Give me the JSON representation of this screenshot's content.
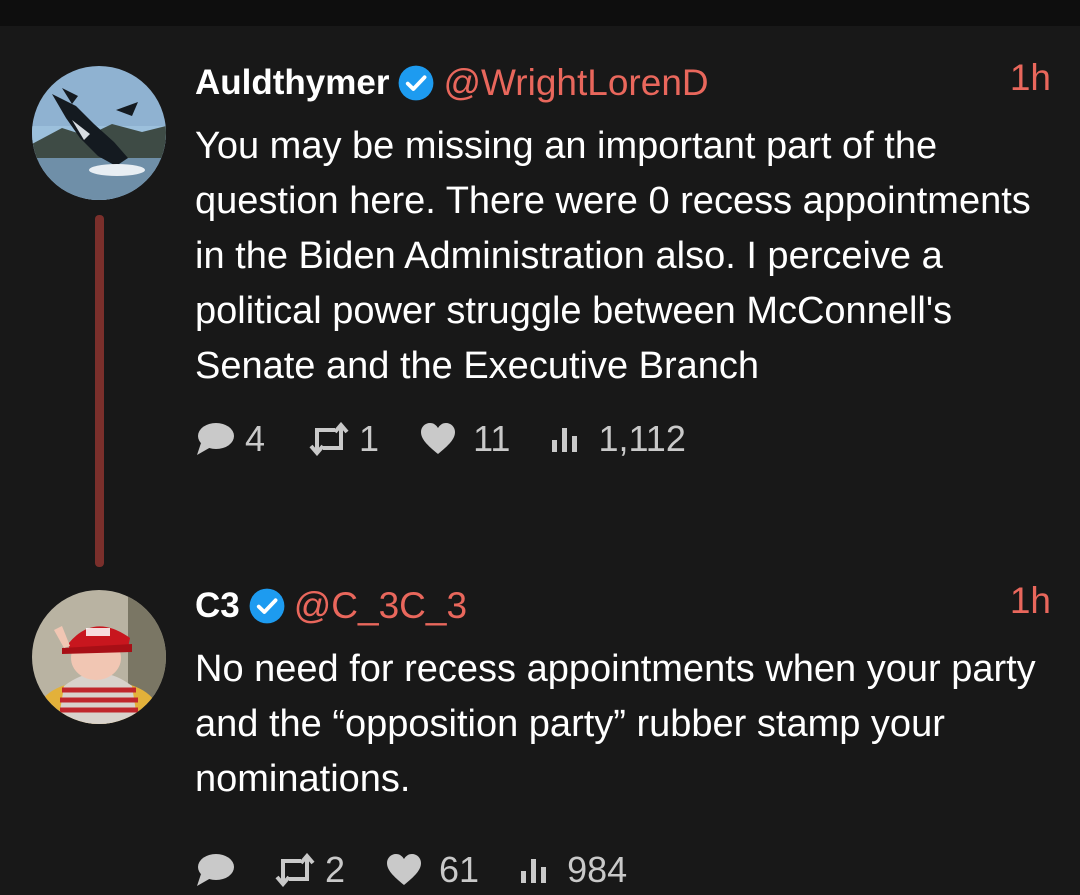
{
  "tweets": [
    {
      "display_name": "Auldthymer",
      "handle": "@WrightLorenD",
      "time": "1h",
      "text": "You may be missing an important part of the question here.  There were 0 recess appointments in the Biden Administration also.  I perceive a political power struggle between McConnell's Senate and the Executive Branch",
      "stats": {
        "replies": "4",
        "retweets": "1",
        "likes": "11",
        "views": "1,112"
      },
      "avatar_icon": "whale-breach-photo"
    },
    {
      "display_name": "C3",
      "handle": "@C_3C_3",
      "time": "1h",
      "text": "No need for recess appointments when your party and the “opposition party” rubber stamp your nominations.",
      "stats": {
        "retweets": "2",
        "likes": "61",
        "views": "984"
      },
      "avatar_icon": "child-red-cap-photo"
    }
  ],
  "colors": {
    "background": "#181818",
    "accent": "#e9675c",
    "verified": "#1d9bf0",
    "thread_line": "#7a2f2b",
    "stats_text": "#c9c9c9"
  }
}
